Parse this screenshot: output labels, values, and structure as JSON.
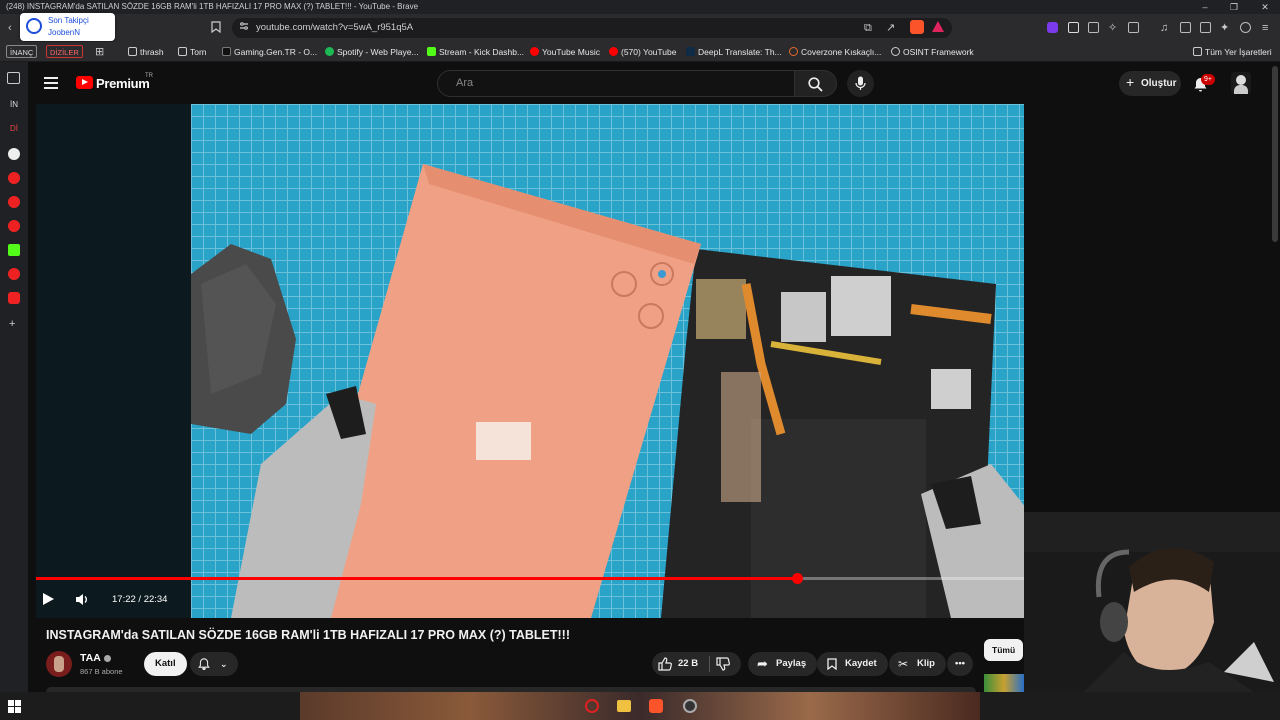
{
  "window": {
    "title": "(248) INSTAGRAM'da SATILAN SÖZDE 16GB RAM'li 1TB HAFIZALI 17 PRO MAX (?) TABLET!!! - YouTube - Brave"
  },
  "address_bar": {
    "url": "youtube.com/watch?v=5wA_r951q5A"
  },
  "follow_popup": {
    "line1": "Son Takipçi",
    "line2": "JoobenN"
  },
  "bookmarks": {
    "chip1": "İNANÇ",
    "chip2": "DİZİLER",
    "items": [
      "thrash",
      "Torn",
      "Gaming.Gen.TR - O...",
      "Spotify - Web Playe...",
      "Stream - Kick Dashb...",
      "YouTube Music",
      "(570) YouTube",
      "DeepL Translate: Th...",
      "Coverzone Kıskaçlı...",
      "OSINT Framework"
    ],
    "all_bookmarks": "Tüm Yer İşaretleri"
  },
  "sidebar": {
    "label1": "İN",
    "label2": "Dİ"
  },
  "youtube": {
    "logo_text": "Premium",
    "region": "TR",
    "search_placeholder": "Ara",
    "create_label": "Oluştur",
    "notif_count": "9+"
  },
  "player": {
    "time": "17:22 / 22:34",
    "progress": 0.7699
  },
  "video": {
    "title": "INSTAGRAM'da SATILAN SÖZDE 16GB RAM'li 1TB HAFIZALI 17 PRO MAX (?) TABLET!!!",
    "channel": "TAA",
    "subscribers": "867 B abone",
    "join_label": "Katıl",
    "likes": "22 B",
    "share_label": "Paylaş",
    "save_label": "Kaydet",
    "clip_label": "Klip",
    "all_label": "Tümü"
  },
  "colors": {
    "accent": "#ff0000",
    "background": "#0f0f0f"
  }
}
